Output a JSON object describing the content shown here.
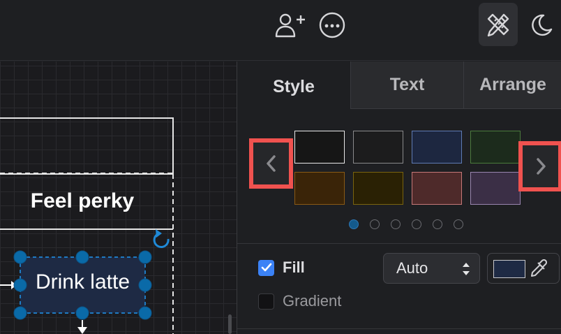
{
  "toolbar": {
    "add_user_icon": "person-add-icon",
    "more_icon": "ellipsis-icon",
    "format_icon": "format-panel-icon",
    "theme_icon": "moon-icon"
  },
  "canvas": {
    "lane_label": "Feel perky",
    "selected_shape_label": "Drink latte",
    "selected_shape_fill": "#1e2a44",
    "handle_color": "#0a6aa8"
  },
  "panel": {
    "tabs": [
      {
        "label": "Style",
        "active": true
      },
      {
        "label": "Text",
        "active": false
      },
      {
        "label": "Arrange",
        "active": false
      }
    ],
    "swatches": [
      {
        "fill": "#161616",
        "border": "#e8e8e8"
      },
      {
        "fill": "#1c1c1d",
        "border": "#8a8a8c"
      },
      {
        "fill": "#1d2740",
        "border": "#5f7bb4"
      },
      {
        "fill": "#1c2b1c",
        "border": "#4b7a3c"
      },
      {
        "fill": "#3a2408",
        "border": "#8a5a14"
      },
      {
        "fill": "#2a2104",
        "border": "#7a640e"
      },
      {
        "fill": "#4e2a2a",
        "border": "#c67878"
      },
      {
        "fill": "#3b2f46",
        "border": "#9a85b0"
      }
    ],
    "prev_icon": "chevron-left-icon",
    "next_icon": "chevron-right-icon",
    "page_dots": 6,
    "active_dot": 0,
    "fill_label": "Fill",
    "fill_checked": true,
    "fill_mode": "Auto",
    "fill_color": "#1e2a44",
    "gradient_label": "Gradient",
    "gradient_checked": false,
    "highlight_color": "#f0524f"
  }
}
